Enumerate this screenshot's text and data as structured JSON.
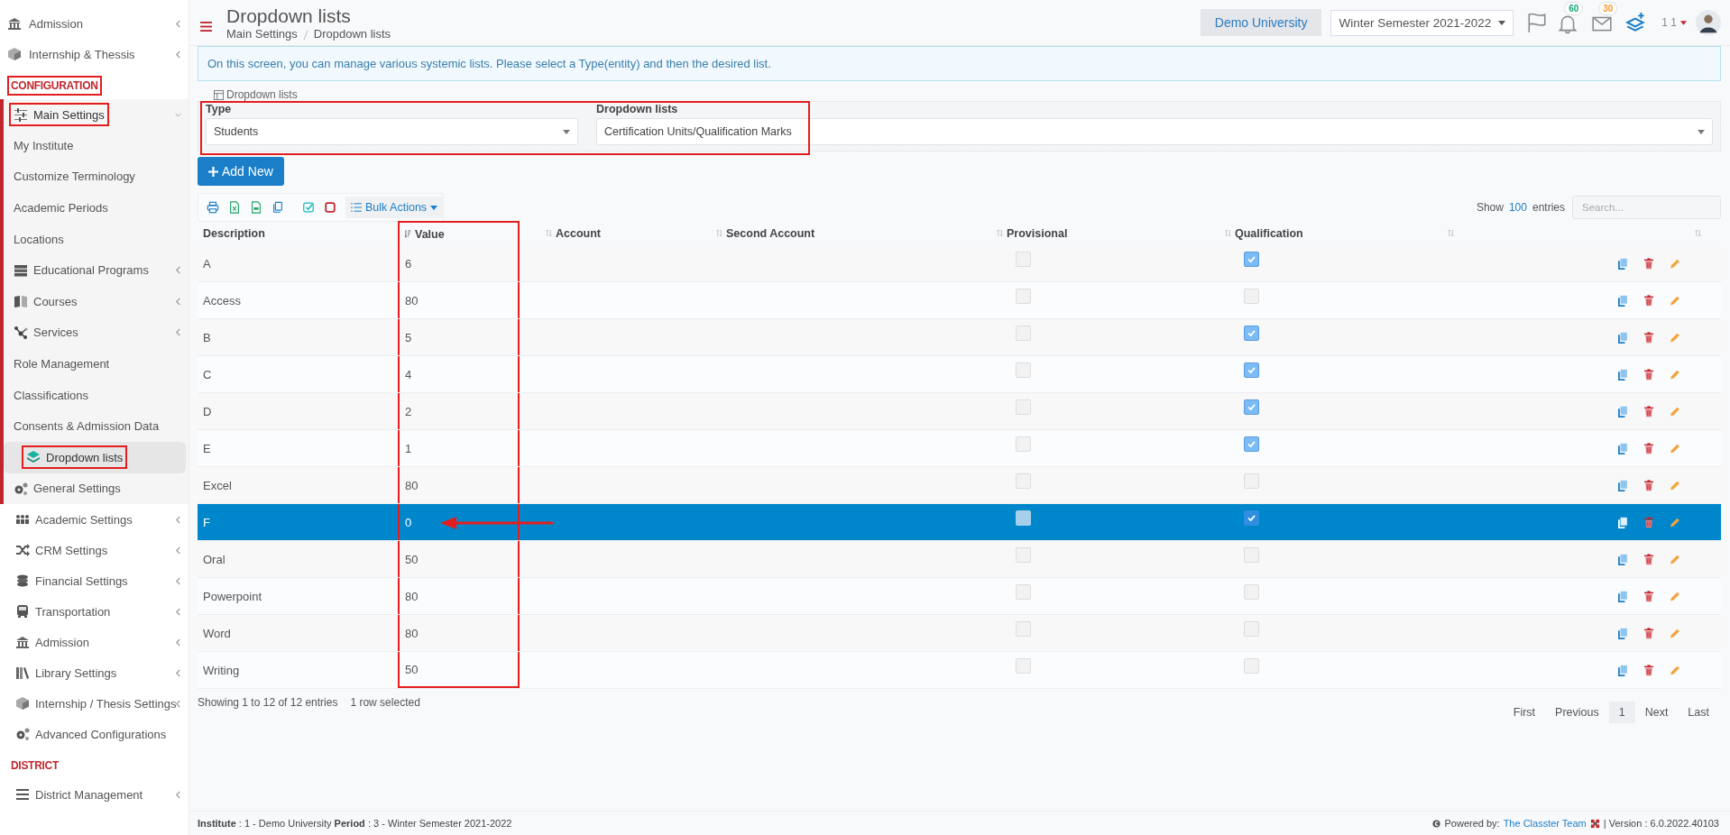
{
  "sidebar": {
    "top_items": [
      {
        "label": "Admission",
        "has_submenu": true
      },
      {
        "label": "Internship & Thessis",
        "has_submenu": true
      }
    ],
    "sections": [
      {
        "title": "CONFIGURATION",
        "annotated": true,
        "items": [
          {
            "label": "Main Settings",
            "has_submenu": true,
            "expanded": true,
            "annotated": true,
            "children": [
              {
                "label": "My Institute",
                "has_submenu": false,
                "selected": false,
                "annotated": false
              },
              {
                "label": "Customize Terminology",
                "has_submenu": false,
                "selected": false,
                "annotated": false
              },
              {
                "label": "Academic Periods",
                "has_submenu": false,
                "selected": false,
                "annotated": false
              },
              {
                "label": "Locations",
                "has_submenu": false,
                "selected": false,
                "annotated": false
              },
              {
                "label": "Educational Programs",
                "has_submenu": true,
                "selected": false,
                "annotated": false
              },
              {
                "label": "Courses",
                "has_submenu": true,
                "selected": false,
                "annotated": false
              },
              {
                "label": "Services",
                "has_submenu": true,
                "selected": false,
                "annotated": false
              },
              {
                "label": "Role Management",
                "has_submenu": false,
                "selected": false,
                "annotated": false
              },
              {
                "label": "Classifications",
                "has_submenu": false,
                "selected": false,
                "annotated": false
              },
              {
                "label": "Consents & Admission Data",
                "has_submenu": false,
                "selected": false,
                "annotated": false
              },
              {
                "label": "Dropdown lists",
                "has_submenu": false,
                "selected": true,
                "annotated": true
              },
              {
                "label": "General Settings",
                "has_submenu": false,
                "selected": false,
                "annotated": false
              }
            ]
          },
          {
            "label": "Academic Settings",
            "has_submenu": true,
            "expanded": false,
            "annotated": false
          },
          {
            "label": "CRM Settings",
            "has_submenu": true,
            "expanded": false,
            "annotated": false
          },
          {
            "label": "Financial Settings",
            "has_submenu": true,
            "expanded": false,
            "annotated": false
          },
          {
            "label": "Transportation",
            "has_submenu": true,
            "expanded": false,
            "annotated": false
          },
          {
            "label": "Admission",
            "has_submenu": true,
            "expanded": false,
            "annotated": false
          },
          {
            "label": "Library Settings",
            "has_submenu": true,
            "expanded": false,
            "annotated": false
          },
          {
            "label": "Internship / Thesis Settings",
            "has_submenu": true,
            "expanded": false,
            "annotated": false
          },
          {
            "label": "Advanced Configurations",
            "has_submenu": false,
            "expanded": false,
            "annotated": false
          }
        ]
      },
      {
        "title": "DISTRICT",
        "annotated": false,
        "items": [
          {
            "label": "District Management",
            "has_submenu": true,
            "expanded": false,
            "annotated": false
          }
        ]
      }
    ]
  },
  "header": {
    "title": "Dropdown lists",
    "breadcrumb": [
      "Main Settings",
      "Dropdown lists"
    ],
    "institution": "Demo University",
    "period": "Winter Semester 2021-2022",
    "notifications_badge": "60",
    "messages_badge": "30",
    "user": "1 1"
  },
  "info_message": "On this screen, you can manage various systemic lists. Please select a Type(entity) and then the desired list.",
  "filter": {
    "legend": "Dropdown lists",
    "annotated": true,
    "type": {
      "label": "Type",
      "value": "Students"
    },
    "list": {
      "label": "Dropdown lists",
      "value": "Certification Units/Qualification Marks"
    }
  },
  "add_button": "Add New",
  "toolbar": {
    "bulk_actions": "Bulk Actions",
    "show": "Show",
    "page_size": "100",
    "entries": "entries",
    "search_placeholder": "Search..."
  },
  "table": {
    "columns": [
      {
        "label": "Description",
        "sortable": false,
        "sorted": false,
        "annotated": false
      },
      {
        "label": "Value",
        "sorted": true,
        "annotated": true
      },
      {
        "label": "Account",
        "sortable": true,
        "sorted": false,
        "annotated": false
      },
      {
        "label": "Second Account",
        "sortable": true,
        "sorted": false,
        "annotated": false
      },
      {
        "label": "Provisional",
        "sortable": true,
        "sorted": false,
        "annotated": false
      },
      {
        "label": "Qualification",
        "sortable": true,
        "sorted": false,
        "annotated": false
      },
      {
        "sortable": true,
        "sorted": false,
        "annotated": false
      },
      {
        "sortable": true,
        "sorted": false,
        "annotated": false
      }
    ],
    "rows": [
      {
        "description": "A",
        "value": "6",
        "provisional": false,
        "qualification": true,
        "selected": false,
        "annotated": false
      },
      {
        "description": "Access",
        "value": "80",
        "provisional": false,
        "qualification": false,
        "selected": false,
        "annotated": false
      },
      {
        "description": "B",
        "value": "5",
        "provisional": false,
        "qualification": true,
        "selected": false,
        "annotated": false
      },
      {
        "description": "C",
        "value": "4",
        "provisional": false,
        "qualification": true,
        "selected": false,
        "annotated": false
      },
      {
        "description": "D",
        "value": "2",
        "provisional": false,
        "qualification": true,
        "selected": false,
        "annotated": false
      },
      {
        "description": "E",
        "value": "1",
        "provisional": false,
        "qualification": true,
        "selected": false,
        "annotated": false
      },
      {
        "description": "Excel",
        "value": "80",
        "provisional": false,
        "qualification": false,
        "selected": false,
        "annotated": false
      },
      {
        "description": "F",
        "value": "0",
        "provisional": false,
        "qualification": true,
        "selected": true,
        "annotated": true
      },
      {
        "description": "Oral",
        "value": "50",
        "provisional": false,
        "qualification": false,
        "selected": false,
        "annotated": false
      },
      {
        "description": "Powerpoint",
        "value": "80",
        "provisional": false,
        "qualification": false,
        "selected": false,
        "annotated": false
      },
      {
        "description": "Word",
        "value": "80",
        "provisional": false,
        "qualification": false,
        "selected": false,
        "annotated": false
      },
      {
        "description": "Writing",
        "value": "50",
        "provisional": false,
        "qualification": false,
        "selected": false,
        "annotated": false
      }
    ],
    "info": "Showing 1 to 12 of 12 entries",
    "selection_info": "1 row selected"
  },
  "pagination": [
    {
      "label": "First",
      "selected": false
    },
    {
      "label": "Previous",
      "selected": false
    },
    {
      "label": "1",
      "selected": true
    },
    {
      "label": "Next",
      "selected": false
    },
    {
      "label": "Last",
      "selected": false
    }
  ],
  "footer": {
    "context": "**Institute** : 1 - Demo University **Period** : 3 - Winter Semester 2021-2022",
    "powered_by": "Powered by:",
    "team_link": "The Classter Team",
    "version": "| Version : 6.0.2022.40103"
  }
}
